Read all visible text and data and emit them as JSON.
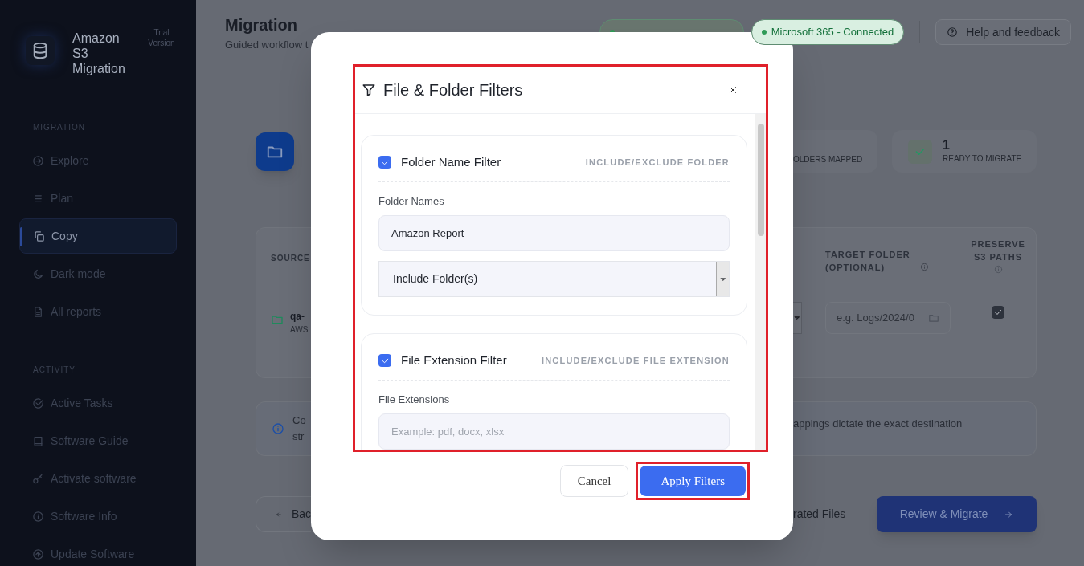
{
  "sidebar": {
    "app_name": "Amazon S3 Migration",
    "badge": "Trial Version",
    "sections": [
      {
        "title": "MIGRATION",
        "items": [
          {
            "label": "Explore",
            "selected": false
          },
          {
            "label": "Plan",
            "selected": false
          },
          {
            "label": "Copy",
            "selected": true
          },
          {
            "label": "Dark mode",
            "selected": false
          },
          {
            "label": "All reports",
            "selected": false
          }
        ]
      },
      {
        "title": "ACTIVITY",
        "items": [
          {
            "label": "Active Tasks",
            "selected": false
          },
          {
            "label": "Software Guide",
            "selected": false
          },
          {
            "label": "Activate software",
            "selected": false
          },
          {
            "label": "Software Info",
            "selected": false
          },
          {
            "label": "Update Software",
            "selected": false
          }
        ]
      }
    ]
  },
  "header": {
    "title": "Migration",
    "subtitle": "Guided workflow t",
    "connections": [
      {
        "kind": "covered"
      },
      {
        "kind": "visible",
        "label": "Microsoft 365 - Connected"
      }
    ],
    "help_button": "Help and feedback"
  },
  "background": {
    "stats": [
      {
        "label": "OLDERS MAPPED"
      },
      {
        "value": "1",
        "label": "READY TO MIGRATE"
      }
    ],
    "table": {
      "column_1": "SOURCE",
      "target_header": "TARGET FOLDER (OPTIONAL)",
      "preserve_header": "PRESERVE S3 PATHS",
      "row": {
        "name": "qa-",
        "sub": "AWS",
        "target_placeholder": "e.g. Logs/2024/0",
        "preserve_checked": true
      }
    },
    "info": {
      "left_lines": [
        "Co",
        "str"
      ],
      "right_text": "appings dictate the exact destination"
    },
    "footer": {
      "back": "Bac",
      "middle": "rated Files",
      "primary": "Review & Migrate"
    }
  },
  "dialog": {
    "title": "File & Folder Filters",
    "highlighted": true,
    "filters": [
      {
        "kind": "folder",
        "label": "Folder Name Filter",
        "checked": true,
        "tag": "INCLUDE/EXCLUDE FOLDER",
        "field_label": "Folder Names",
        "value": "Amazon Report",
        "select": "Include Folder(s)"
      },
      {
        "kind": "extension",
        "label": "File Extension Filter",
        "checked": true,
        "tag": "INCLUDE/EXCLUDE FILE EXTENSION",
        "field_label": "File Extensions",
        "placeholder": "Example: pdf, docx, xlsx"
      }
    ],
    "buttons": [
      {
        "label": "Cancel",
        "kind": "secondary",
        "highlighted": false
      },
      {
        "label": "Apply Filters",
        "kind": "primary",
        "highlighted": true
      }
    ]
  }
}
